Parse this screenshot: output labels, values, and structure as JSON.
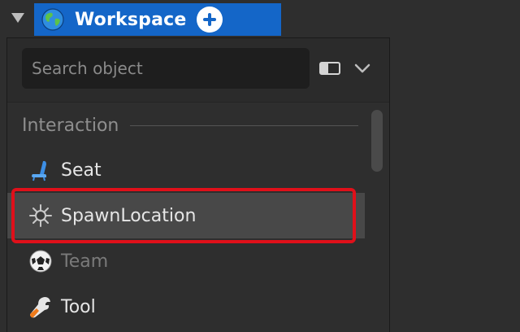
{
  "explorer": {
    "root_item": {
      "label": "Workspace",
      "icon": "globe-icon",
      "color": "#1466c8"
    }
  },
  "insert_popup": {
    "search": {
      "placeholder": "Search object",
      "value": ""
    },
    "category": "Interaction",
    "items": [
      {
        "label": "Seat",
        "icon": "seat-icon",
        "state": "normal"
      },
      {
        "label": "SpawnLocation",
        "icon": "spawn-location-icon",
        "state": "selected"
      },
      {
        "label": "Team",
        "icon": "team-ball-icon",
        "state": "disabled"
      },
      {
        "label": "Tool",
        "icon": "wrench-icon",
        "state": "normal"
      }
    ]
  },
  "highlight_color": "#e0101a"
}
